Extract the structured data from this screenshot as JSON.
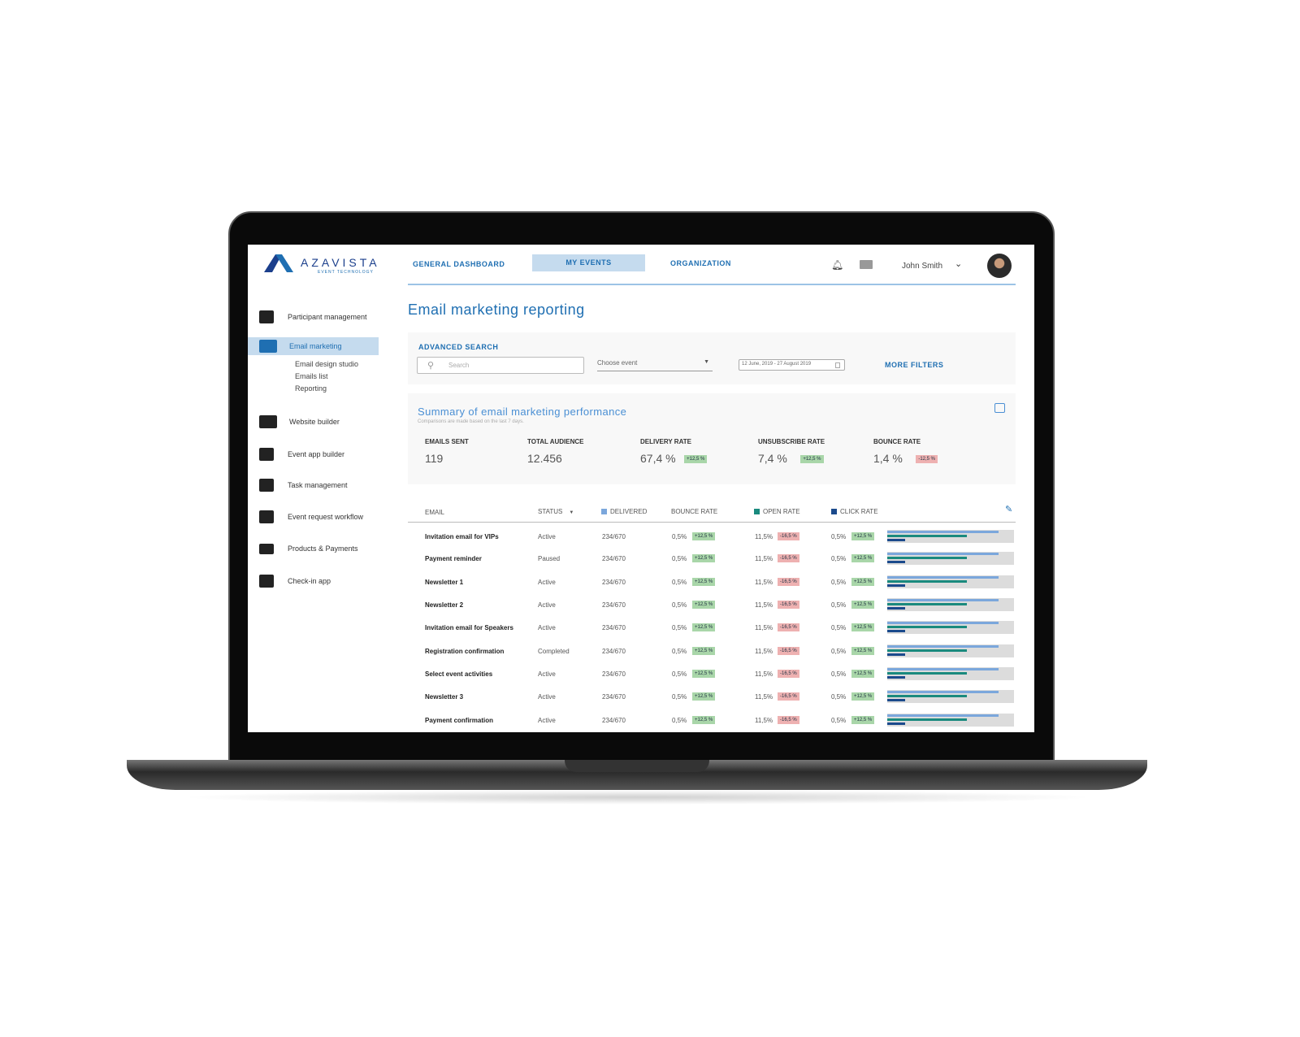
{
  "brand": {
    "name": "AZAVISTA",
    "tagline": "EVENT TECHNOLOGY"
  },
  "nav": {
    "tabs": [
      {
        "label": "GENERAL DASHBOARD"
      },
      {
        "label": "MY EVENTS",
        "active": true
      },
      {
        "label": "ORGANIZATION"
      }
    ],
    "user": "John Smith"
  },
  "sidebar": {
    "items": [
      {
        "label": "Participant management",
        "icon": "person-icon"
      },
      {
        "label": "Email marketing",
        "icon": "contact-card-icon",
        "active": true,
        "children": [
          "Email design studio",
          "Emails list",
          "Reporting"
        ]
      },
      {
        "label": "Website builder",
        "icon": "images-icon"
      },
      {
        "label": "Event app builder",
        "icon": "app-settings-icon"
      },
      {
        "label": "Task management",
        "icon": "calendar-icon"
      },
      {
        "label": "Event request workflow",
        "icon": "share-screen-icon"
      },
      {
        "label": "Products & Payments",
        "icon": "credit-card-icon"
      },
      {
        "label": "Check-in app",
        "icon": "server-icon"
      }
    ]
  },
  "page": {
    "title": "Email marketing reporting"
  },
  "search": {
    "title": "ADVANCED SEARCH",
    "placeholder": "Search",
    "event_select": "Choose event",
    "date_range": "12 June, 2019 - 27 August 2019",
    "more_filters": "MORE FILTERS"
  },
  "summary": {
    "title": "Summary of email marketing performance",
    "subtitle": "Comparisons are made based on the last 7 days.",
    "kpis": [
      {
        "label": "EMAILS SENT",
        "value": "119"
      },
      {
        "label": "TOTAL AUDIENCE",
        "value": "12.456"
      },
      {
        "label": "DELIVERY RATE",
        "value": "67,4 %",
        "delta": "+12,5 %",
        "trend": "up"
      },
      {
        "label": "UNSUBSCRIBE RATE",
        "value": "7,4 %",
        "delta": "+12,5 %",
        "trend": "up"
      },
      {
        "label": "BOUNCE RATE",
        "value": "1,4 %",
        "delta": "-12,5 %",
        "trend": "down"
      }
    ]
  },
  "table": {
    "headers": {
      "email": "EMAIL",
      "status": "STATUS",
      "delivered": "DELIVERED",
      "bounce": "BOUNCE RATE",
      "open": "OPEN RATE",
      "click": "CLICK RATE"
    },
    "colors": {
      "delivered": "#7ba7dc",
      "open": "#1a8a7e",
      "click": "#1b4a8c"
    },
    "rows": [
      {
        "email": "Invitation email for VIPs",
        "status": "Active",
        "delivered": "234/670",
        "bounce": "0,5%",
        "bounce_delta": "+12,5 %",
        "open": "11,5%",
        "open_delta": "-16,5 %",
        "click": "0,5%",
        "click_delta": "+12,5 %",
        "bars": {
          "delivered": 88,
          "open": 63,
          "click": 14
        }
      },
      {
        "email": "Payment reminder",
        "status": "Paused",
        "delivered": "234/670",
        "bounce": "0,5%",
        "bounce_delta": "+12,5 %",
        "open": "11,5%",
        "open_delta": "-16,5 %",
        "click": "0,5%",
        "click_delta": "+12,5 %",
        "bars": {
          "delivered": 88,
          "open": 63,
          "click": 14
        }
      },
      {
        "email": "Newsletter 1",
        "status": "Active",
        "delivered": "234/670",
        "bounce": "0,5%",
        "bounce_delta": "+12,5 %",
        "open": "11,5%",
        "open_delta": "-16,5 %",
        "click": "0,5%",
        "click_delta": "+12,5 %",
        "bars": {
          "delivered": 88,
          "open": 63,
          "click": 14
        }
      },
      {
        "email": "Newsletter 2",
        "status": "Active",
        "delivered": "234/670",
        "bounce": "0,5%",
        "bounce_delta": "+12,5 %",
        "open": "11,5%",
        "open_delta": "-16,5 %",
        "click": "0,5%",
        "click_delta": "+12,5 %",
        "bars": {
          "delivered": 88,
          "open": 63,
          "click": 14
        }
      },
      {
        "email": "Invitation email for Speakers",
        "status": "Active",
        "delivered": "234/670",
        "bounce": "0,5%",
        "bounce_delta": "+12,5 %",
        "open": "11,5%",
        "open_delta": "-16,5 %",
        "click": "0,5%",
        "click_delta": "+12,5 %",
        "bars": {
          "delivered": 88,
          "open": 63,
          "click": 14
        }
      },
      {
        "email": "Registration confirmation",
        "status": "Completed",
        "delivered": "234/670",
        "bounce": "0,5%",
        "bounce_delta": "+12,5 %",
        "open": "11,5%",
        "open_delta": "-16,5 %",
        "click": "0,5%",
        "click_delta": "+12,5 %",
        "bars": {
          "delivered": 88,
          "open": 63,
          "click": 14
        }
      },
      {
        "email": "Select event activities",
        "status": "Active",
        "delivered": "234/670",
        "bounce": "0,5%",
        "bounce_delta": "+12,5 %",
        "open": "11,5%",
        "open_delta": "-16,5 %",
        "click": "0,5%",
        "click_delta": "+12,5 %",
        "bars": {
          "delivered": 88,
          "open": 63,
          "click": 14
        }
      },
      {
        "email": "Newsletter 3",
        "status": "Active",
        "delivered": "234/670",
        "bounce": "0,5%",
        "bounce_delta": "+12,5 %",
        "open": "11,5%",
        "open_delta": "-16,5 %",
        "click": "0,5%",
        "click_delta": "+12,5 %",
        "bars": {
          "delivered": 88,
          "open": 63,
          "click": 14
        }
      },
      {
        "email": "Payment confirmation",
        "status": "Active",
        "delivered": "234/670",
        "bounce": "0,5%",
        "bounce_delta": "+12,5 %",
        "open": "11,5%",
        "open_delta": "-16,5 %",
        "click": "0,5%",
        "click_delta": "+12,5 %",
        "bars": {
          "delivered": 88,
          "open": 63,
          "click": 14
        }
      }
    ]
  }
}
